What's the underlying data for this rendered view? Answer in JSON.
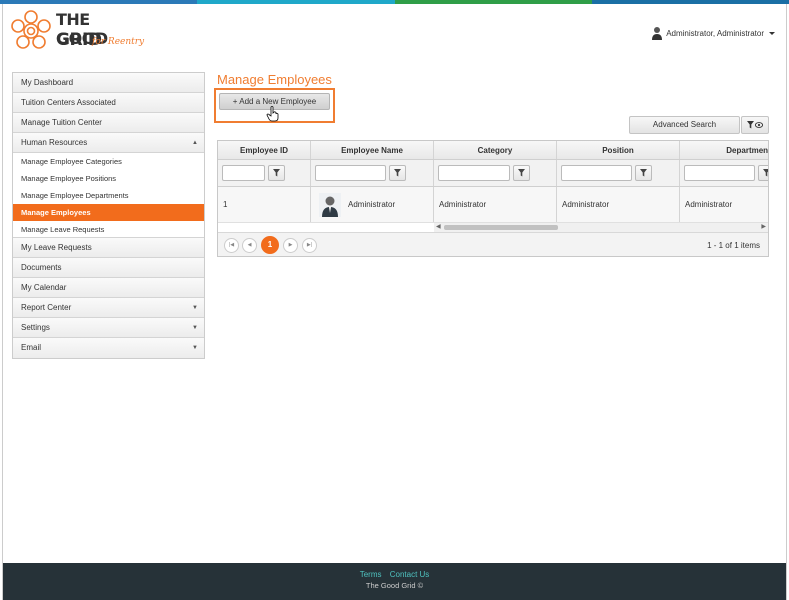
{
  "brand": {
    "line1": "THE GOOD",
    "line2": "GRID",
    "tagline": "for Reentry",
    "accent": "#f07d31"
  },
  "topbar_colors": [
    "#2b7ab8",
    "#1fa8c9",
    "#2f9e48",
    "#1a6fa5"
  ],
  "user_menu": {
    "label": "Administrator, Administrator",
    "icon": "user-avatar-icon"
  },
  "sidebar": {
    "items": [
      {
        "label": "My Dashboard"
      },
      {
        "label": "Tuition Centers Associated"
      },
      {
        "label": "Manage Tuition Center"
      },
      {
        "label": "Human Resources",
        "expanded": true
      },
      {
        "label": "My Leave Requests"
      },
      {
        "label": "Documents"
      },
      {
        "label": "My Calendar"
      },
      {
        "label": "Report Center"
      },
      {
        "label": "Settings"
      },
      {
        "label": "Email"
      }
    ],
    "subitems": [
      {
        "label": "Manage Employee Categories"
      },
      {
        "label": "Manage Employee Positions"
      },
      {
        "label": "Manage Employee Departments"
      },
      {
        "label": "Manage Employees",
        "active": true
      },
      {
        "label": "Manage Leave Requests"
      }
    ]
  },
  "main": {
    "title": "Manage Employees",
    "add_button": "+ Add a New Employee",
    "advanced_search": "Advanced Search"
  },
  "grid": {
    "columns": [
      "Employee ID",
      "Employee Name",
      "Category",
      "Position",
      "Department"
    ],
    "rows": [
      {
        "id": "1",
        "name": "Administrator",
        "category": "Administrator",
        "position": "Administrator",
        "department": "Administrator"
      }
    ],
    "pager": {
      "current_page": "1",
      "info": "1 - 1 of 1 items"
    }
  },
  "footer": {
    "terms": "Terms",
    "contact": "Contact Us",
    "copyright": "The Good Grid ©"
  }
}
